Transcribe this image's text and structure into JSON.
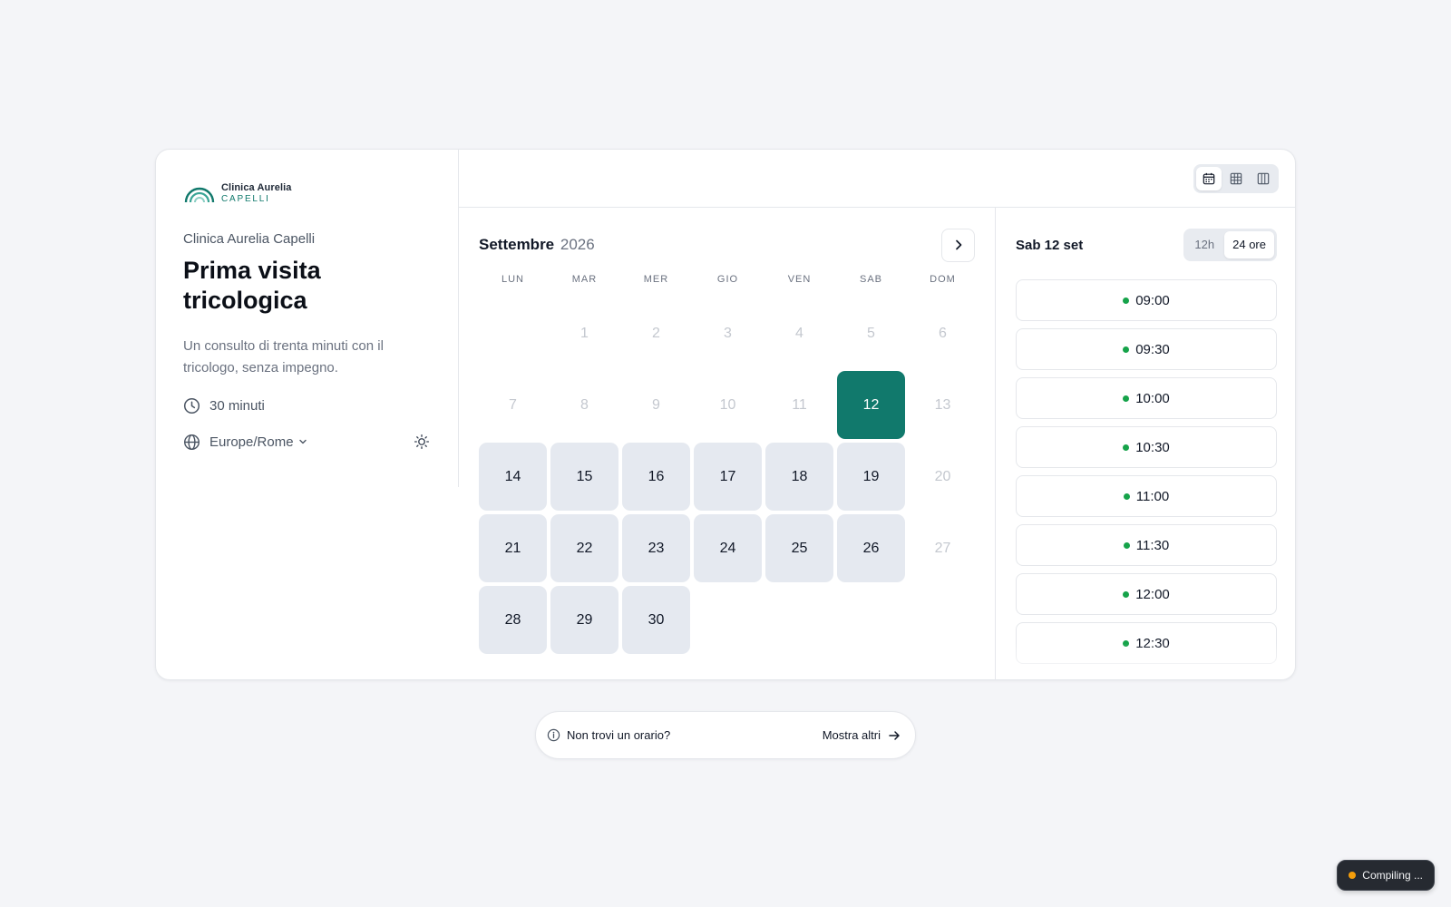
{
  "brand": {
    "line1": "Clinica Aurelia",
    "line2": "CAPELLI",
    "color": "#11796c"
  },
  "event": {
    "org": "Clinica Aurelia Capelli",
    "title": "Prima visita tricologica",
    "description": "Un consulto di trenta minuti con il tricologo, senza impegno.",
    "duration": "30 minuti",
    "duration_icon": "clock-icon",
    "timezone": "Europe/Rome",
    "timezone_icon": "globe-icon",
    "theme_icon": "sun-icon"
  },
  "view_toggle": {
    "options": [
      "month-view",
      "week-view",
      "column-view"
    ],
    "active": "month-view"
  },
  "calendar": {
    "month": "Settembre",
    "year": "2026",
    "weekdays": [
      "LUN",
      "MAR",
      "MER",
      "GIO",
      "VEN",
      "SAB",
      "DOM"
    ],
    "leading_blank_days": 1,
    "days": [
      {
        "n": "1",
        "state": "muted"
      },
      {
        "n": "2",
        "state": "muted"
      },
      {
        "n": "3",
        "state": "muted"
      },
      {
        "n": "4",
        "state": "muted"
      },
      {
        "n": "5",
        "state": "muted"
      },
      {
        "n": "6",
        "state": "muted"
      },
      {
        "n": "7",
        "state": "muted"
      },
      {
        "n": "8",
        "state": "muted"
      },
      {
        "n": "9",
        "state": "muted"
      },
      {
        "n": "10",
        "state": "muted"
      },
      {
        "n": "11",
        "state": "muted"
      },
      {
        "n": "12",
        "state": "selected"
      },
      {
        "n": "13",
        "state": "muted"
      },
      {
        "n": "14",
        "state": "avail"
      },
      {
        "n": "15",
        "state": "avail"
      },
      {
        "n": "16",
        "state": "avail"
      },
      {
        "n": "17",
        "state": "avail"
      },
      {
        "n": "18",
        "state": "avail"
      },
      {
        "n": "19",
        "state": "avail"
      },
      {
        "n": "20",
        "state": "muted"
      },
      {
        "n": "21",
        "state": "avail"
      },
      {
        "n": "22",
        "state": "avail"
      },
      {
        "n": "23",
        "state": "avail"
      },
      {
        "n": "24",
        "state": "avail"
      },
      {
        "n": "25",
        "state": "avail"
      },
      {
        "n": "26",
        "state": "avail"
      },
      {
        "n": "27",
        "state": "muted"
      },
      {
        "n": "28",
        "state": "avail"
      },
      {
        "n": "29",
        "state": "avail"
      },
      {
        "n": "30",
        "state": "avail"
      }
    ]
  },
  "slots": {
    "date_label": "Sab 12 set",
    "format_options": [
      "12h",
      "24 ore"
    ],
    "active_format": "24 ore",
    "times": [
      "09:00",
      "09:30",
      "10:00",
      "10:30",
      "11:00",
      "11:30",
      "12:00",
      "12:30"
    ]
  },
  "help": {
    "question": "Non trovi un orario?",
    "action": "Mostra altri"
  },
  "status": {
    "label": "Compiling ...",
    "dot_color": "#f59e0b"
  }
}
